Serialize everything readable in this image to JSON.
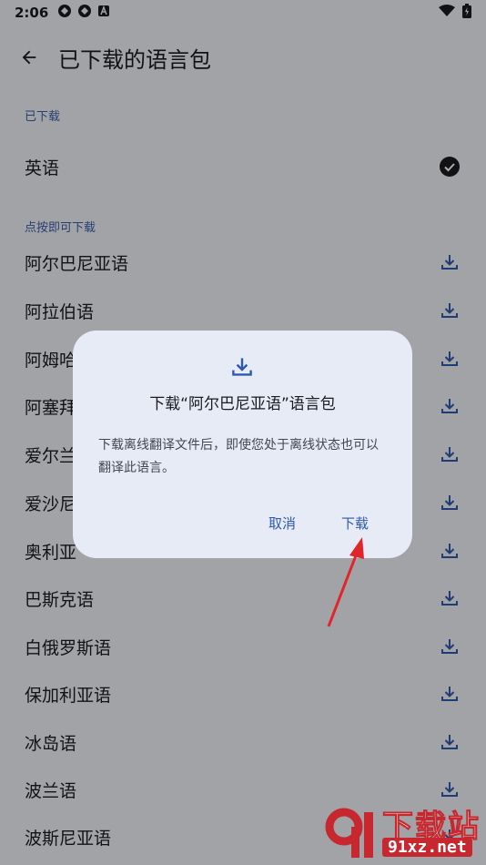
{
  "status_bar": {
    "time": "2:06"
  },
  "app_bar": {
    "title": "已下载的语言包"
  },
  "downloaded": {
    "label": "已下载",
    "items": [
      {
        "name": "英语"
      }
    ]
  },
  "available": {
    "label": "点按即可下载",
    "items": [
      {
        "name": "阿尔巴尼亚语"
      },
      {
        "name": "阿拉伯语"
      },
      {
        "name": "阿姆哈"
      },
      {
        "name": "阿塞拜"
      },
      {
        "name": "爱尔兰"
      },
      {
        "name": "爱沙尼"
      },
      {
        "name": "奥利亚"
      },
      {
        "name": "巴斯克语"
      },
      {
        "name": "白俄罗斯语"
      },
      {
        "name": "保加利亚语"
      },
      {
        "name": "冰岛语"
      },
      {
        "name": "波兰语"
      },
      {
        "name": "波斯尼亚语"
      }
    ]
  },
  "dialog": {
    "title": "下载“阿尔巴尼亚语”语言包",
    "body": "下载离线翻译文件后，即使您处于离线状态也可以翻译此语言。",
    "cancel_label": "取消",
    "confirm_label": "下载"
  },
  "watermark": {
    "text": "下载站",
    "url": "91xz.net"
  },
  "colors": {
    "accent": "#2e5aac",
    "section_label": "#3b5ca8",
    "annotation_arrow": "#e0262a",
    "watermark": "#c7282f"
  }
}
